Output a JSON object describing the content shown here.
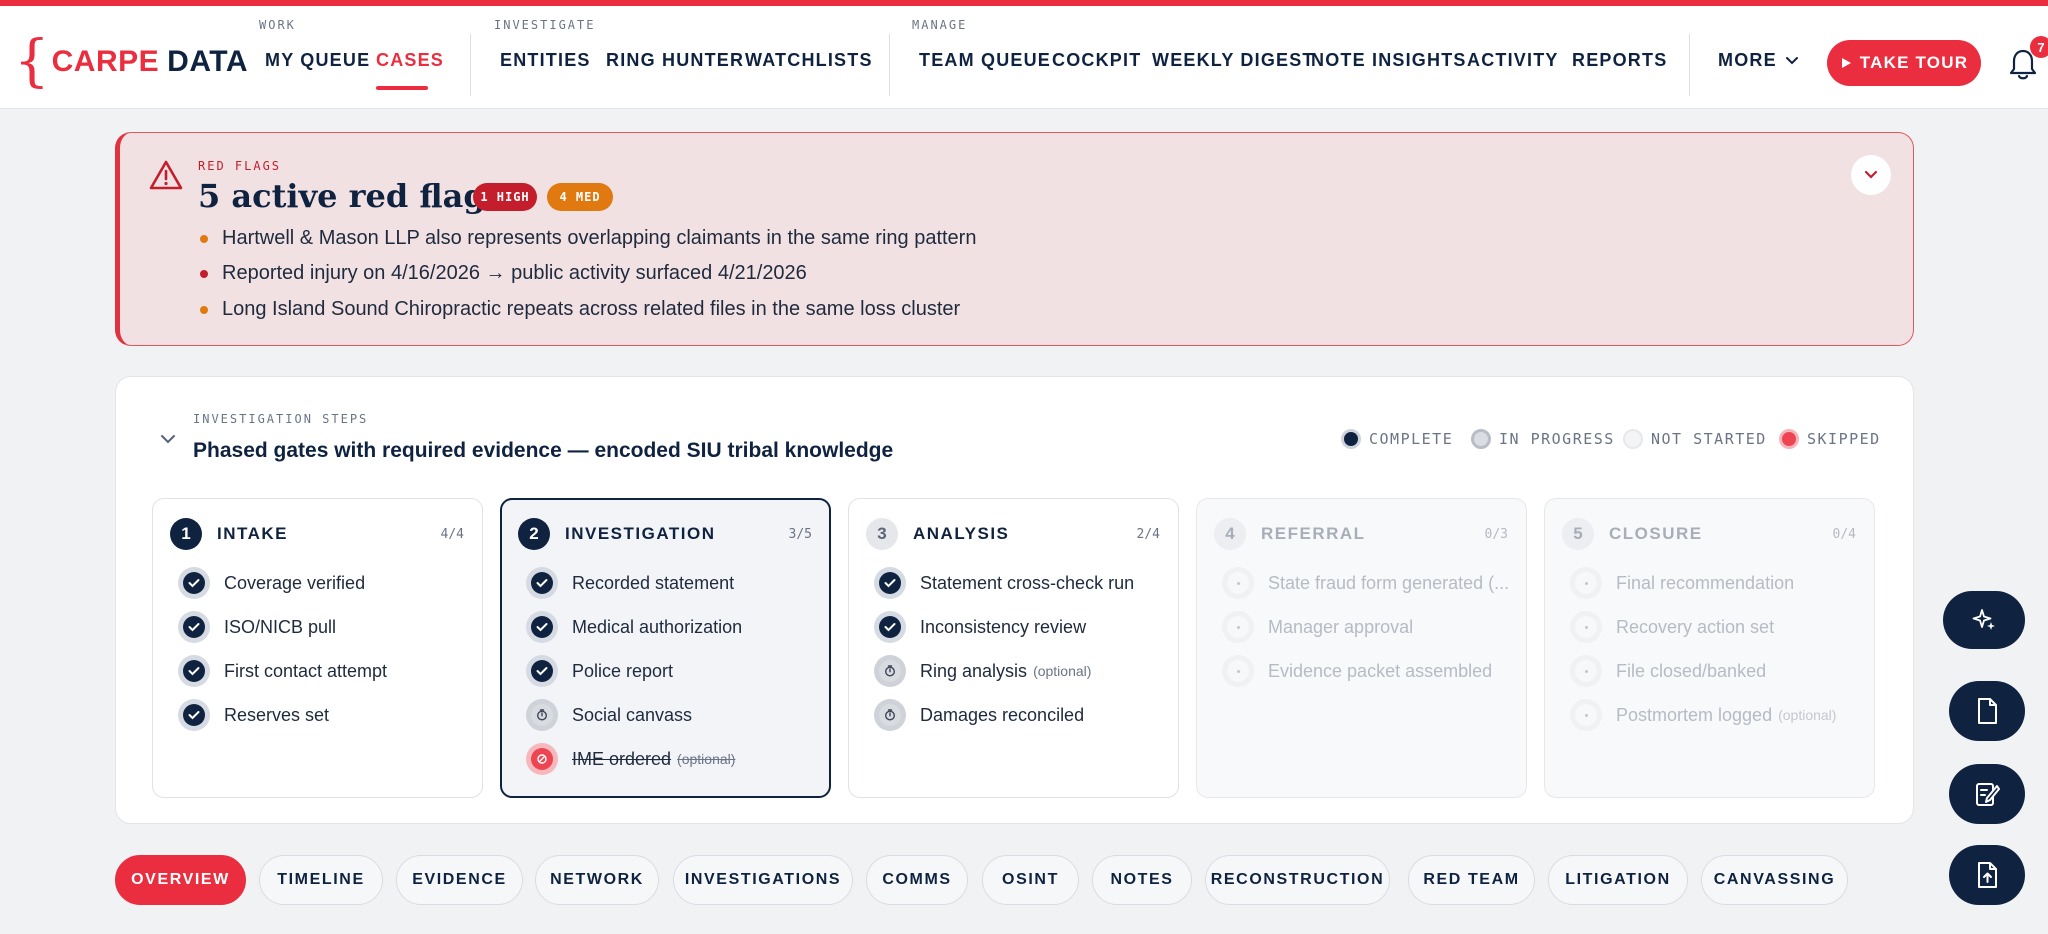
{
  "brand": {
    "open": "{",
    "carpe": "CARPE",
    "data": "DATA"
  },
  "nav": {
    "groups": {
      "work": "WORK",
      "investigate": "INVESTIGATE",
      "manage": "MANAGE"
    },
    "links": {
      "my_queue": "MY QUEUE",
      "cases": "CASES",
      "entities": "ENTITIES",
      "ring_hunter": "RING HUNTER",
      "watchlists": "WATCHLISTS",
      "team_queue": "TEAM QUEUE",
      "cockpit": "COCKPIT",
      "weekly_digest": "WEEKLY DIGEST",
      "note_insights": "NOTE INSIGHTS",
      "activity": "ACTIVITY",
      "reports": "REPORTS"
    },
    "active": "cases",
    "more": "MORE",
    "tour": "TAKE TOUR",
    "notifications": "7"
  },
  "red_flags": {
    "eyebrow": "RED FLAGS",
    "title": "5 active red flags",
    "badge_high": "1 HIGH",
    "badge_med": "4 MED",
    "items": [
      {
        "text": "Hartwell & Mason LLP also represents overlapping claimants in the same ring pattern",
        "severity": "med"
      },
      {
        "text": "Reported injury on 4/16/2026 → public activity surfaced 4/21/2026",
        "severity": "high"
      },
      {
        "text": "Long Island Sound Chiropractic repeats across related files in the same loss cluster",
        "severity": "med"
      }
    ],
    "colors": {
      "high": "#c41e2c",
      "med": "#e07a10"
    }
  },
  "steps": {
    "eyebrow": "INVESTIGATION STEPS",
    "title": "Phased gates with required evidence — encoded SIU tribal knowledge",
    "legend": {
      "complete": "COMPLETE",
      "in_progress": "IN PROGRESS",
      "not_started": "NOT STARTED",
      "skipped": "SKIPPED"
    },
    "phases": [
      {
        "num": "1",
        "name": "INTAKE",
        "count": "4/4",
        "tasks": [
          {
            "label": "Coverage verified",
            "opt": ""
          },
          {
            "label": "ISO/NICB pull",
            "opt": ""
          },
          {
            "label": "First contact attempt",
            "opt": ""
          },
          {
            "label": "Reserves set",
            "opt": ""
          }
        ]
      },
      {
        "num": "2",
        "name": "INVESTIGATION",
        "count": "3/5",
        "tasks": [
          {
            "label": "Recorded statement",
            "opt": ""
          },
          {
            "label": "Medical authorization",
            "opt": ""
          },
          {
            "label": "Police report",
            "opt": ""
          },
          {
            "label": "Social canvass",
            "opt": ""
          },
          {
            "label": "IME ordered",
            "opt": "(optional)"
          }
        ]
      },
      {
        "num": "3",
        "name": "ANALYSIS",
        "count": "2/4",
        "tasks": [
          {
            "label": "Statement cross-check run",
            "opt": ""
          },
          {
            "label": "Inconsistency review",
            "opt": ""
          },
          {
            "label": "Ring analysis",
            "opt": "(optional)"
          },
          {
            "label": "Damages reconciled",
            "opt": ""
          }
        ]
      },
      {
        "num": "4",
        "name": "REFERRAL",
        "count": "0/3",
        "tasks": [
          {
            "label": "State fraud form generated (...",
            "opt": ""
          },
          {
            "label": "Manager approval",
            "opt": ""
          },
          {
            "label": "Evidence packet assembled",
            "opt": ""
          }
        ]
      },
      {
        "num": "5",
        "name": "CLOSURE",
        "count": "0/4",
        "tasks": [
          {
            "label": "Final recommendation",
            "opt": ""
          },
          {
            "label": "Recovery action set",
            "opt": ""
          },
          {
            "label": "File closed/banked",
            "opt": ""
          },
          {
            "label": "Postmortem logged",
            "opt": "(optional)"
          }
        ]
      }
    ]
  },
  "tabs": {
    "overview": "OVERVIEW",
    "timeline": "TIMELINE",
    "evidence": "EVIDENCE",
    "network": "NETWORK",
    "investigations": "INVESTIGATIONS",
    "comms": "COMMS",
    "osint": "OSINT",
    "notes": "NOTES",
    "reconstruction": "RECONSTRUCTION",
    "red_team": "RED TEAM",
    "litigation": "LITIGATION",
    "canvassing": "CANVASSING"
  },
  "active_tab": "overview",
  "fabs": [
    "sparkle-icon",
    "document-icon",
    "notes-edit-icon",
    "file-upload-icon"
  ],
  "colors": {
    "accent": "#ea2e3f",
    "navy": "#0f2340",
    "flag_bg": "#f1e1e3"
  }
}
